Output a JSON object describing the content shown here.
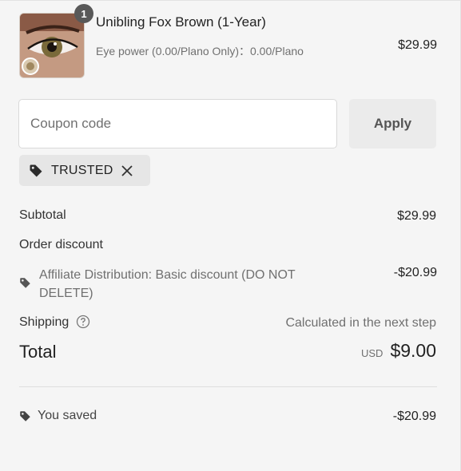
{
  "product": {
    "quantity": "1",
    "title": "Unibling Fox Brown (1-Year)",
    "variant": "Eye power (0.00/Plano Only)：0.00/Plano",
    "price": "$29.99"
  },
  "coupon": {
    "placeholder": "Coupon code",
    "value": "",
    "apply_label": "Apply",
    "applied_code": "TRUSTED"
  },
  "summary": {
    "subtotal_label": "Subtotal",
    "subtotal_value": "$29.99",
    "order_discount_label": "Order discount",
    "discount_name": "Affiliate Distribution: Basic discount (DO NOT DELETE)",
    "discount_value": "-$20.99",
    "shipping_label": "Shipping",
    "shipping_value": "Calculated in the next step",
    "total_label": "Total",
    "total_currency": "USD",
    "total_value": "$9.00",
    "saved_label": "You saved",
    "saved_value": "-$20.99"
  },
  "icons": {
    "tag": "tag-icon",
    "close": "close-icon",
    "help": "help-circle-icon"
  }
}
